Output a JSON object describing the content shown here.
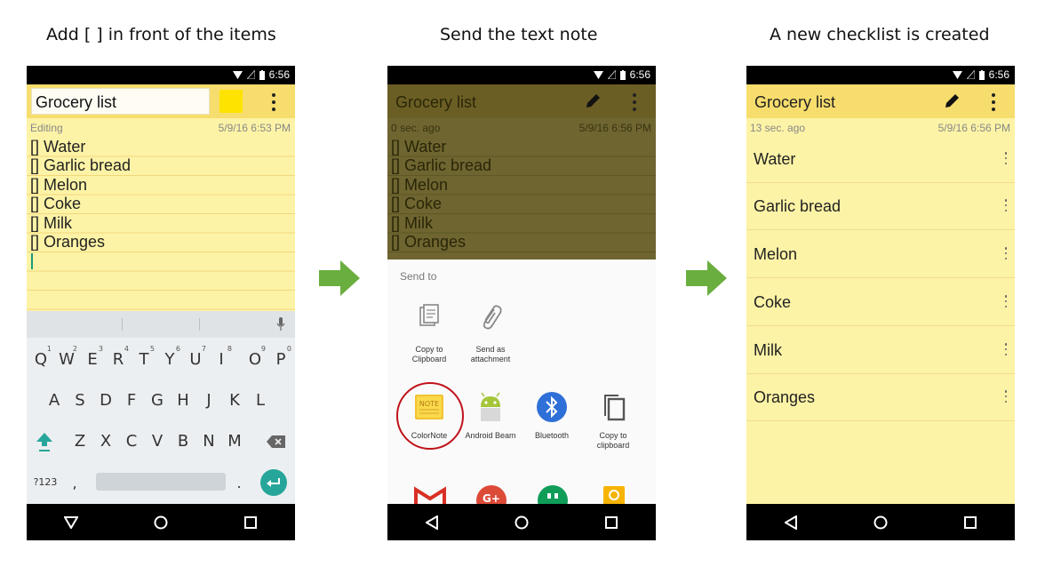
{
  "steps": [
    {
      "title": "Add [ ] in front of the items"
    },
    {
      "title": "Send the text note"
    },
    {
      "title": "A new checklist is created"
    }
  ],
  "status_time": "6:56",
  "note": {
    "title": "Grocery list",
    "editing_label": "Editing",
    "editing_timestamp": "5/9/16 6:53 PM",
    "sent_label": "0 sec. ago",
    "sent_timestamp": "5/9/16 6:56 PM",
    "checklist_label": "13 sec. ago",
    "checklist_timestamp": "5/9/16 6:56 PM",
    "text_lines": [
      "[] Water",
      "[] Garlic bread",
      "[] Melon",
      "[] Coke",
      "[] Milk",
      "[] Oranges"
    ],
    "checklist_items": [
      "Water",
      "Garlic bread",
      "Melon",
      "Coke",
      "Milk",
      "Oranges"
    ]
  },
  "keyboard": {
    "row1": [
      "Q",
      "W",
      "E",
      "R",
      "T",
      "Y",
      "U",
      "I",
      "O",
      "P"
    ],
    "row1_hints": [
      "1",
      "2",
      "3",
      "4",
      "5",
      "6",
      "7",
      "8",
      "9",
      "0"
    ],
    "row2": [
      "A",
      "S",
      "D",
      "F",
      "G",
      "H",
      "J",
      "K",
      "L"
    ],
    "row3": [
      "Z",
      "X",
      "C",
      "V",
      "B",
      "N",
      "M"
    ],
    "symbols_key": "?123",
    "comma_key": ",",
    "period_key": "."
  },
  "share": {
    "header": "Send to",
    "row1": [
      {
        "label_line1": "Copy to",
        "label_line2": "Clipboard",
        "icon": "clipboard-icon"
      },
      {
        "label_line1": "Send as",
        "label_line2": "attachment",
        "icon": "paperclip-icon"
      }
    ],
    "row2": [
      {
        "label_line1": "ColorNote",
        "label_line2": "",
        "icon": "colornote-icon"
      },
      {
        "label_line1": "Android Beam",
        "label_line2": "",
        "icon": "android-icon"
      },
      {
        "label_line1": "Bluetooth",
        "label_line2": "",
        "icon": "bluetooth-icon"
      },
      {
        "label_line1": "Copy to",
        "label_line2": "clipboard",
        "icon": "copy-icon"
      }
    ],
    "colornote_logo_text": "NOTE",
    "gplus_text": "G+"
  },
  "colors": {
    "note_bg": "#fdf3a6",
    "app_bar": "#f7dd6d",
    "arrow_green": "#6aae3f",
    "highlight_red": "#c0121a"
  }
}
